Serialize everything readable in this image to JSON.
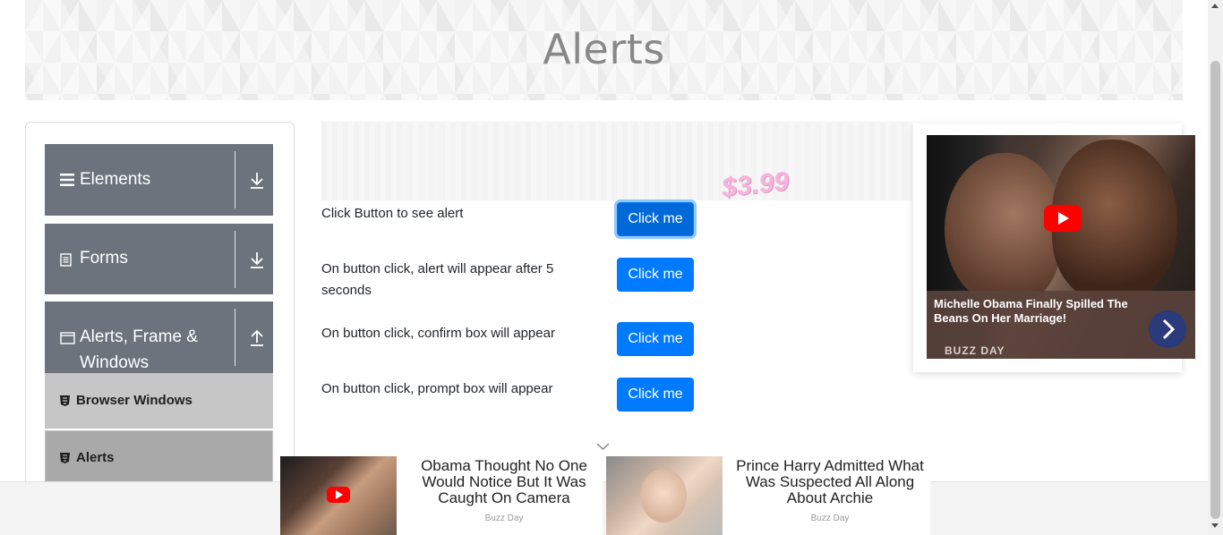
{
  "header": {
    "title": "Alerts"
  },
  "sidebar": {
    "groups": [
      {
        "label": "Elements",
        "icon": "hamburger-icon",
        "arrow": "download-icon"
      },
      {
        "label": "Forms",
        "icon": "document-icon",
        "arrow": "download-icon"
      },
      {
        "label": "Alerts, Frame &",
        "label2": "Windows",
        "icon": "window-icon",
        "arrow": "upload-icon"
      }
    ],
    "items": [
      {
        "label": "Browser Windows",
        "icon": "html5-icon"
      },
      {
        "label": "Alerts",
        "icon": "html5-icon"
      }
    ]
  },
  "main": {
    "ad_price": "$3.99",
    "rows": [
      {
        "text": "Click Button to see alert",
        "button": "Click me"
      },
      {
        "text": "On button click, alert will appear after 5 seconds",
        "button": "Click me"
      },
      {
        "text": "On button click, confirm box will appear",
        "button": "Click me"
      },
      {
        "text": "On button click, prompt box will appear",
        "button": "Click me"
      }
    ]
  },
  "right_ad": {
    "caption": "Michelle Obama Finally Spilled The Beans On Her Marriage!",
    "source": "BUZZ DAY"
  },
  "bottom_ads": [
    {
      "title": "Obama Thought No One Would Notice But It Was Caught On Camera",
      "source": "Buzz Day"
    },
    {
      "title": "Prince Harry Admitted What Was Suspected All Along About Archie",
      "source": "Buzz Day"
    }
  ],
  "colors": {
    "primary": "#007bff",
    "sidebar_group": "#6c737c",
    "sidebar_item": "#c6c6c6",
    "sidebar_item_active": "#a9a9a9"
  }
}
